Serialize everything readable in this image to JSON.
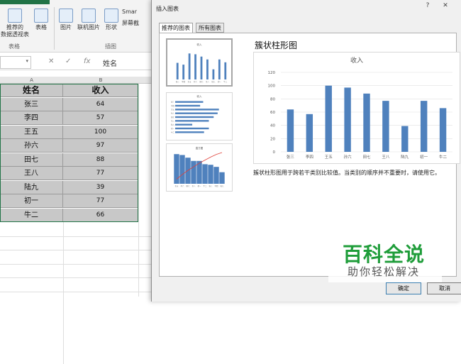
{
  "ribbon": {
    "buttons": [
      {
        "id": "recommended-pivot",
        "label": "推荐的\n数据透视表"
      },
      {
        "id": "table",
        "label": "表格"
      },
      {
        "id": "pictures",
        "label": "图片"
      },
      {
        "id": "online-pictures",
        "label": "联机图片"
      },
      {
        "id": "shapes",
        "label": "形状"
      },
      {
        "id": "smartart",
        "label": "Smar"
      },
      {
        "id": "screenshot",
        "label": "屏幕截"
      }
    ],
    "groups": {
      "tables": "表格",
      "illustrations": "插图"
    }
  },
  "formula_bar": {
    "fx": "fx",
    "value": "姓名"
  },
  "columns": [
    "A",
    "B"
  ],
  "sheet": {
    "headers": [
      "姓名",
      "收入"
    ],
    "rows": [
      {
        "name": "张三",
        "value": "64"
      },
      {
        "name": "李四",
        "value": "57"
      },
      {
        "name": "王五",
        "value": "100"
      },
      {
        "name": "孙六",
        "value": "97"
      },
      {
        "name": "田七",
        "value": "88"
      },
      {
        "name": "王八",
        "value": "77"
      },
      {
        "name": "陆九",
        "value": "39"
      },
      {
        "name": "初一",
        "value": "77"
      },
      {
        "name": "牛二",
        "value": "66"
      }
    ]
  },
  "dialog": {
    "title": "插入图表",
    "help": "?",
    "close": "✕",
    "tabs": [
      "推荐的图表",
      "所有图表"
    ],
    "selected_chart_name": "簇状柱形图",
    "description": "簇状柱形图用于跨若干类别比较值。当类别的顺序并不重要时，请使用它。",
    "ok": "确定",
    "cancel": "取消",
    "thumb_titles": [
      "收入",
      "收入",
      "直方图"
    ]
  },
  "chart_data": {
    "type": "bar",
    "title": "收入",
    "categories": [
      "张三",
      "李四",
      "王五",
      "孙六",
      "田七",
      "王八",
      "陆九",
      "初一",
      "牛二"
    ],
    "values": [
      64,
      57,
      100,
      97,
      88,
      77,
      39,
      77,
      66
    ],
    "ylim": [
      0,
      120
    ],
    "yticks": [
      0,
      20,
      40,
      60,
      80,
      100,
      120
    ],
    "grid": true,
    "bar_color": "#4f81bd"
  },
  "watermark": {
    "main": "百科全说",
    "sub": "助你轻松解决"
  },
  "colors": {
    "accent": "#217346",
    "bar": "#4f81bd",
    "watermark": "#1f9d3a"
  }
}
